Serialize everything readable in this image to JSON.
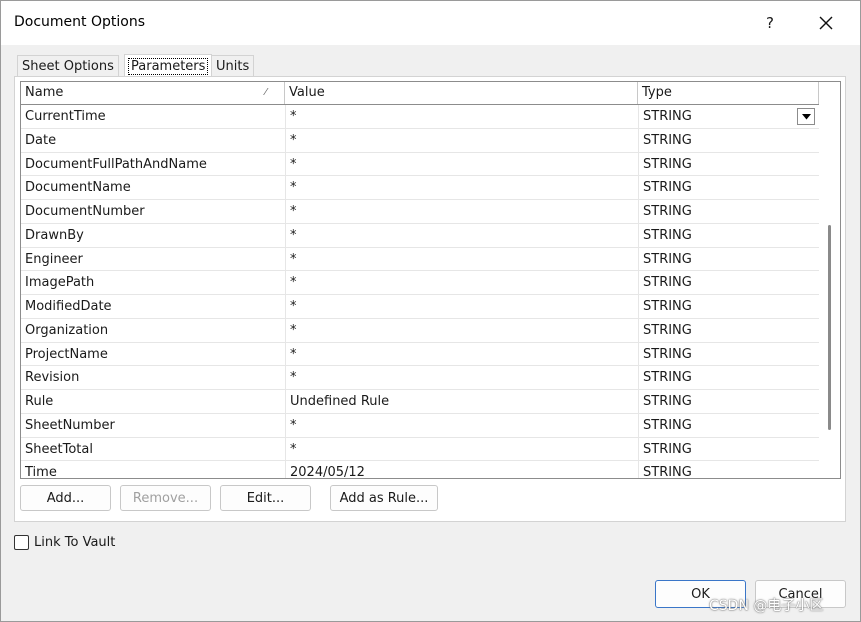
{
  "window": {
    "title": "Document Options",
    "help_label": "?"
  },
  "tabs": [
    {
      "label": "Sheet Options",
      "active": false
    },
    {
      "label": "Parameters",
      "active": true
    },
    {
      "label": "Units",
      "active": false
    }
  ],
  "table": {
    "columns": [
      "Name",
      "Value",
      "Type"
    ],
    "rows": [
      {
        "name": "CurrentTime",
        "value": "*",
        "type": "STRING"
      },
      {
        "name": "Date",
        "value": "*",
        "type": "STRING"
      },
      {
        "name": "DocumentFullPathAndName",
        "value": "*",
        "type": "STRING"
      },
      {
        "name": "DocumentName",
        "value": "*",
        "type": "STRING"
      },
      {
        "name": "DocumentNumber",
        "value": "*",
        "type": "STRING"
      },
      {
        "name": "DrawnBy",
        "value": "*",
        "type": "STRING"
      },
      {
        "name": "Engineer",
        "value": "*",
        "type": "STRING"
      },
      {
        "name": "ImagePath",
        "value": "*",
        "type": "STRING"
      },
      {
        "name": "ModifiedDate",
        "value": "*",
        "type": "STRING"
      },
      {
        "name": "Organization",
        "value": "*",
        "type": "STRING"
      },
      {
        "name": "ProjectName",
        "value": "*",
        "type": "STRING"
      },
      {
        "name": "Revision",
        "value": "*",
        "type": "STRING"
      },
      {
        "name": "Rule",
        "value": "Undefined Rule",
        "type": "STRING"
      },
      {
        "name": "SheetNumber",
        "value": "*",
        "type": "STRING"
      },
      {
        "name": "SheetTotal",
        "value": "*",
        "type": "STRING"
      },
      {
        "name": "Time",
        "value": "2024/05/12",
        "type": "STRING"
      }
    ]
  },
  "buttons": {
    "add": "Add...",
    "remove": "Remove...",
    "edit": "Edit...",
    "add_as_rule": "Add as Rule...",
    "ok": "OK",
    "cancel": "Cancel"
  },
  "link_to_vault": {
    "label": "Link To Vault",
    "checked": false
  },
  "watermark": "CSDN @电子小区",
  "colors": {
    "dialog_bg": "#f0f0f0",
    "primary_border": "#3a76c8"
  }
}
